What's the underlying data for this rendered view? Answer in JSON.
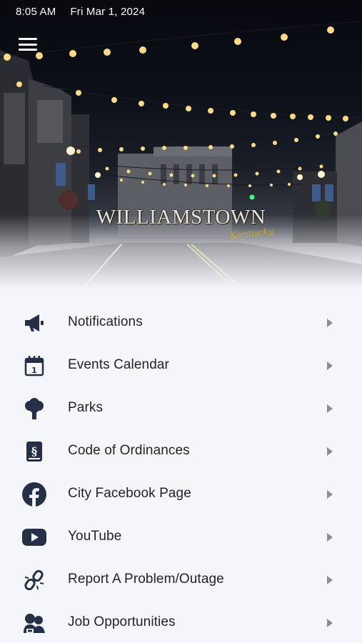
{
  "status_bar": {
    "time": "8:05 AM",
    "date": "Fri Mar 1, 2024"
  },
  "hero": {
    "brand_name": "WILLIAMSTOWN",
    "brand_state": "Kentucky"
  },
  "colors": {
    "icon": "#253046",
    "text": "#222326",
    "chevron": "#8a8d92",
    "background": "#f4f6f9"
  },
  "menu": [
    {
      "label": "Notifications",
      "icon": "megaphone-icon"
    },
    {
      "label": "Events Calendar",
      "icon": "calendar-icon"
    },
    {
      "label": "Parks",
      "icon": "tree-icon"
    },
    {
      "label": "Code of Ordinances",
      "icon": "ordinance-book-icon"
    },
    {
      "label": "City Facebook Page",
      "icon": "facebook-icon"
    },
    {
      "label": "YouTube",
      "icon": "youtube-icon"
    },
    {
      "label": "Report A Problem/Outage",
      "icon": "broken-link-icon"
    },
    {
      "label": "Job Opportunities",
      "icon": "job-people-icon"
    }
  ]
}
